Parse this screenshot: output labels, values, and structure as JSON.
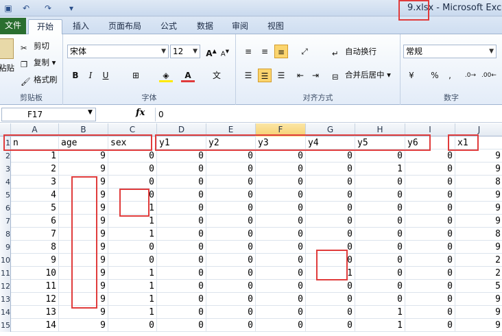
{
  "window": {
    "title": "9.xlsx  -  Microsoft Excel"
  },
  "tabs": [
    "文件",
    "开始",
    "插入",
    "页面布局",
    "公式",
    "数据",
    "审阅",
    "视图"
  ],
  "ribbon": {
    "clipboard": {
      "paste": "粘贴",
      "cut": "剪切",
      "copy": "复制",
      "format_painter": "格式刷",
      "label": "剪贴板"
    },
    "font": {
      "font_name": "宋体",
      "font_size": "12",
      "bold": "B",
      "italic": "I",
      "underline": "U",
      "label": "字体"
    },
    "alignment": {
      "wrap_text": "自动换行",
      "merge_center": "合并后居中",
      "label": "对齐方式"
    },
    "number": {
      "format": "常规",
      "percent": "%",
      "comma": ",",
      "label": "数字"
    }
  },
  "formula_bar": {
    "cell_ref": "F17",
    "fx": "fx",
    "value": "0"
  },
  "sheet": {
    "columns": [
      "A",
      "B",
      "C",
      "D",
      "E",
      "F",
      "G",
      "H",
      "I",
      "J"
    ],
    "active_column": "F",
    "row_numbers": [
      "1",
      "2",
      "3",
      "4",
      "5",
      "6",
      "7",
      "8",
      "9",
      "10",
      "11",
      "12",
      "13",
      "14",
      "15"
    ],
    "rows": [
      [
        "n",
        "age",
        "sex",
        "y1",
        "y2",
        "y3",
        "y4",
        "y5",
        "y6",
        "x1"
      ],
      [
        "1",
        "9",
        "0",
        "0",
        "0",
        "0",
        "0",
        "0",
        "0",
        "9"
      ],
      [
        "2",
        "9",
        "0",
        "0",
        "0",
        "0",
        "0",
        "1",
        "0",
        "9"
      ],
      [
        "3",
        "9",
        "0",
        "0",
        "0",
        "0",
        "0",
        "0",
        "0",
        "8"
      ],
      [
        "4",
        "9",
        "0",
        "0",
        "0",
        "0",
        "0",
        "0",
        "0",
        "9"
      ],
      [
        "5",
        "9",
        "1",
        "0",
        "0",
        "0",
        "0",
        "0",
        "0",
        "9"
      ],
      [
        "6",
        "9",
        "1",
        "0",
        "0",
        "0",
        "0",
        "0",
        "0",
        "9"
      ],
      [
        "7",
        "9",
        "1",
        "0",
        "0",
        "0",
        "0",
        "0",
        "0",
        "8"
      ],
      [
        "8",
        "9",
        "0",
        "0",
        "0",
        "0",
        "0",
        "0",
        "0",
        "9"
      ],
      [
        "9",
        "9",
        "0",
        "0",
        "0",
        "0",
        "0",
        "0",
        "0",
        "2"
      ],
      [
        "10",
        "9",
        "1",
        "0",
        "0",
        "0",
        "1",
        "0",
        "0",
        "2"
      ],
      [
        "11",
        "9",
        "1",
        "0",
        "0",
        "0",
        "0",
        "0",
        "0",
        "5"
      ],
      [
        "12",
        "9",
        "1",
        "0",
        "0",
        "0",
        "0",
        "0",
        "0",
        "9"
      ],
      [
        "13",
        "9",
        "1",
        "0",
        "0",
        "0",
        "0",
        "1",
        "0",
        "9"
      ],
      [
        "14",
        "9",
        "0",
        "0",
        "0",
        "0",
        "0",
        "1",
        "0",
        "9"
      ]
    ]
  },
  "colors": {
    "highlight": "#e03b3b",
    "file_tab": "#2a6e2f",
    "selected_button": "#fbd56e"
  }
}
